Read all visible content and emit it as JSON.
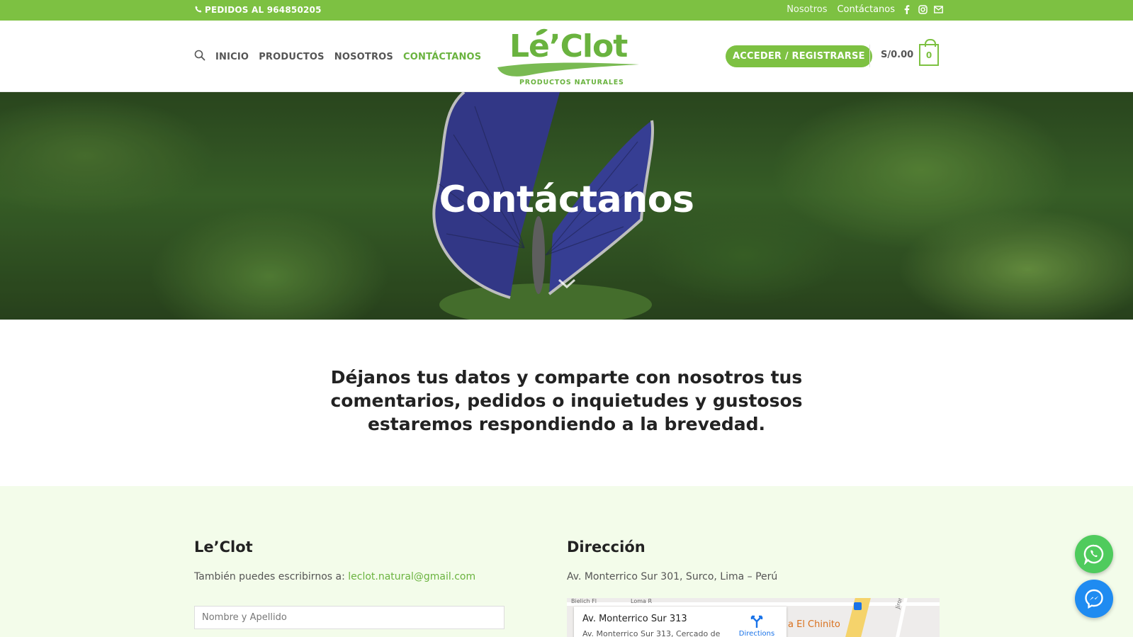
{
  "topbar": {
    "phone_text": "PEDIDOS AL 964850205",
    "links": [
      "Nosotros",
      "Contáctanos"
    ],
    "socials": [
      "facebook-icon",
      "instagram-icon",
      "envelope-icon"
    ],
    "bg_color": "#7dc142"
  },
  "header": {
    "nav": [
      "INICIO",
      "PRODUCTOS",
      "NOSOTROS",
      "CONTÁCTANOS"
    ],
    "active_nav": "CONTÁCTANOS",
    "logo_word": "Le’Clot",
    "logo_tagline": "PRODUCTOS NATURALES",
    "account_button": "ACCEDER / REGISTRARSE",
    "cart_total": "S/0.00",
    "cart_count": "0",
    "accent_color": "#6ab33f"
  },
  "hero": {
    "title": "Contáctanos"
  },
  "intro": {
    "text": "Déjanos tus datos y  comparte con nosotros tus comentarios, pedidos o inquietudes y gustosos estaremos respondiendo a la brevedad."
  },
  "contact": {
    "left_title": "Le’Clot",
    "left_text": "También puedes escribirnos a:",
    "email": "leclot.natural@gmail.com",
    "name_placeholder": "Nombre y Apellido",
    "right_title": "Dirección",
    "address": "Av. Monterrico Sur 301, Surco, Lima – Perú",
    "map": {
      "place_name": "Av. Monterrico Sur 313",
      "place_address": "Av. Monterrico Sur 313, Cercado de",
      "directions": "Directions",
      "poi": "a El Chinito",
      "street1": "Bielich Fl",
      "street2": "Loma R",
      "street3": "Jiron"
    }
  },
  "floating": {
    "whatsapp": "whatsapp-icon",
    "messenger": "messenger-icon"
  }
}
